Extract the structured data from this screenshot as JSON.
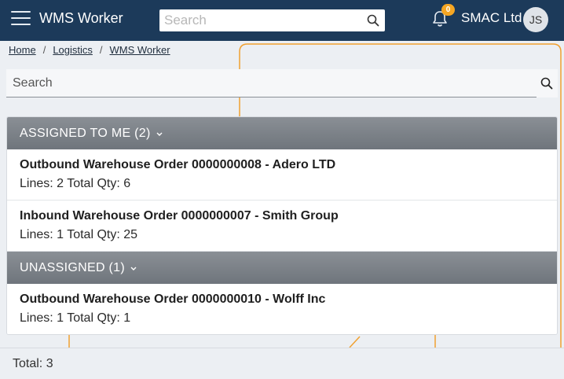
{
  "header": {
    "app_title": "WMS Worker",
    "search_placeholder": "Search",
    "notification_count": "0",
    "company": "SMAC Ltd",
    "user_initials": "JS"
  },
  "breadcrumb": [
    "Home",
    "Logistics",
    "WMS Worker"
  ],
  "page_search": {
    "placeholder": "Search"
  },
  "groups": [
    {
      "label": "ASSIGNED TO ME (2)",
      "items": [
        {
          "title": "Outbound Warehouse Order 0000000008 - Adero LTD",
          "details": "Lines: 2 Total Qty: 6"
        },
        {
          "title": "Inbound Warehouse Order 0000000007 - Smith Group",
          "details": "Lines: 1 Total Qty: 25"
        }
      ]
    },
    {
      "label": "UNASSIGNED (1)",
      "items": [
        {
          "title": "Outbound Warehouse Order 0000000010 - Wolff Inc",
          "details": "Lines: 1 Total Qty: 1"
        }
      ]
    }
  ],
  "footer": {
    "total": "Total: 3"
  },
  "colors": {
    "header_bg": "#1c3a5a",
    "badge": "#f5a623",
    "group_header": "#7a8087",
    "accent_line": "#f0a030"
  }
}
